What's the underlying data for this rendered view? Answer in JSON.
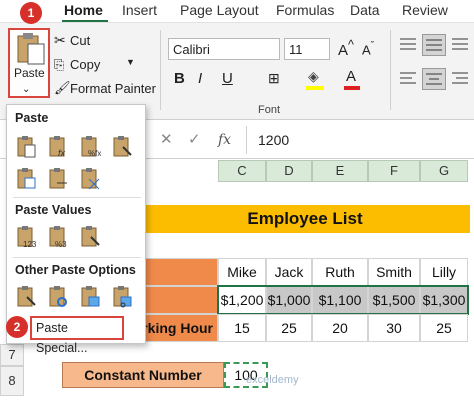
{
  "tabs": [
    "Home",
    "Insert",
    "Page Layout",
    "Formulas",
    "Data",
    "Review"
  ],
  "clipboard": {
    "paste_label": "Paste",
    "cut": "Cut",
    "copy": "Copy",
    "format_painter": "Format Painter"
  },
  "font": {
    "name": "Calibri",
    "size": "11",
    "group_label": "Font"
  },
  "formula_bar": {
    "fx": "fx",
    "value": "1200"
  },
  "columns": [
    "C",
    "D",
    "E",
    "F",
    "G"
  ],
  "rows": [
    "7",
    "8"
  ],
  "sheet": {
    "title": "Employee List",
    "names": [
      "Mike",
      "Jack",
      "Ruth",
      "Smith",
      "Lilly"
    ],
    "salaries": [
      "$1,200",
      "$1,000",
      "$1,100",
      "$1,500",
      "$1,300"
    ],
    "hours_label": "rking Hour",
    "hours": [
      "15",
      "25",
      "20",
      "30",
      "25"
    ],
    "constant_label": "Constant Number",
    "constant_value": "100"
  },
  "dropdown": {
    "section_paste": "Paste",
    "section_values": "Paste Values",
    "section_other": "Other Paste Options",
    "paste_special": "Paste Special..."
  },
  "badges": [
    "1",
    "2"
  ],
  "watermark": "exceldemy",
  "colors": {
    "accent_green": "#217346",
    "highlight_red": "#d9443d",
    "title_yellow": "#fcbd00",
    "header_orange": "#f08a4b"
  }
}
